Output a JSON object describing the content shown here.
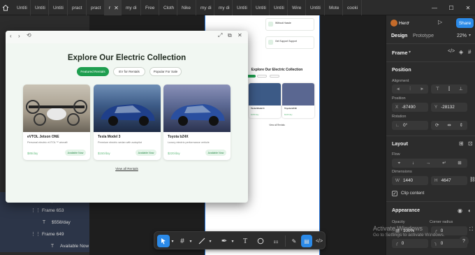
{
  "tabs": [
    {
      "label": "Untiti"
    },
    {
      "label": "Untiti"
    },
    {
      "label": "Untiti"
    },
    {
      "label": "pract"
    },
    {
      "label": "pract"
    },
    {
      "label": "r",
      "close": "✕"
    },
    {
      "label": "my di"
    },
    {
      "label": "Free"
    },
    {
      "label": "Cloth"
    },
    {
      "label": "Nike"
    },
    {
      "label": "my di"
    },
    {
      "label": "my di"
    },
    {
      "label": "Untiti"
    },
    {
      "label": "Untiti"
    },
    {
      "label": "Untiti"
    },
    {
      "label": "Wire"
    },
    {
      "label": "Untiti"
    },
    {
      "label": "Mote"
    },
    {
      "label": "cooki"
    }
  ],
  "window": {
    "minimize": "—",
    "maximize": "☐",
    "close": "✕"
  },
  "layers": [
    {
      "label": "Luxury electric perf",
      "icon": "T"
    },
    {
      "label": "Frame 653",
      "icon": "⋮⋮"
    },
    {
      "label": "$558/day",
      "icon": "T"
    },
    {
      "label": "Frame 649",
      "icon": "⋮⋮"
    },
    {
      "label": "Available Now",
      "icon": "T"
    }
  ],
  "preview": {
    "title": "Explore Our Electric Collection",
    "filters": [
      "Featured Rentals",
      "EV for Rentals",
      "Popular For Sale"
    ],
    "cards": [
      {
        "name": "eVTOL Jetson ONE",
        "desc": "Personal electric eVTOL™ aircraft",
        "price": "$85/day",
        "status": "Available Now"
      },
      {
        "name": "Tesla Model 3",
        "desc": "Premium electric sedan with autopilot",
        "price": "$150/day",
        "status": "Available Now"
      },
      {
        "name": "Toyota bZ4X",
        "desc": "Luxury electric performance vehicle",
        "price": "$220/day",
        "status": "Available Now"
      }
    ],
    "view_all": "View all Rentals"
  },
  "canvas_frame": {
    "title": "Explore Our Electric Collection",
    "cards": [
      {
        "name": "eVTOL Jetson ONE",
        "price": "$85/day"
      },
      {
        "name": "Tesla Model 3",
        "price": "$150/day"
      },
      {
        "name": "Toyota bZ4X",
        "price": "$220/day"
      }
    ],
    "view_all": "View all Rentals",
    "features": [
      "Without Hassle",
      "Get Support Support"
    ]
  },
  "right_panel": {
    "project": "Hero",
    "share": "Share",
    "tabs": [
      "Design",
      "Prototype"
    ],
    "zoom": "22%",
    "frame_label": "Frame",
    "position_heading": "Position",
    "alignment_label": "Alignment",
    "position_label": "Position",
    "x": "-87490",
    "y": "-28132",
    "rotation_label": "Rotation",
    "rotation": "0°",
    "layout_heading": "Layout",
    "flow_label": "Flow",
    "dimensions_label": "Dimensions",
    "w": "1440",
    "h": "4647",
    "clip_content": "Clip content",
    "appearance_heading": "Appearance",
    "opacity_label": "Opacity",
    "corner_label": "Corner radius",
    "opacity": "100%",
    "corner": "0"
  },
  "watermark": {
    "title": "Activate Windows",
    "sub": "Go to Settings to activate Windows."
  },
  "colors": {
    "accent": "#1e9e4f",
    "selection": "#2a7be4",
    "share": "#2b8ae8"
  }
}
